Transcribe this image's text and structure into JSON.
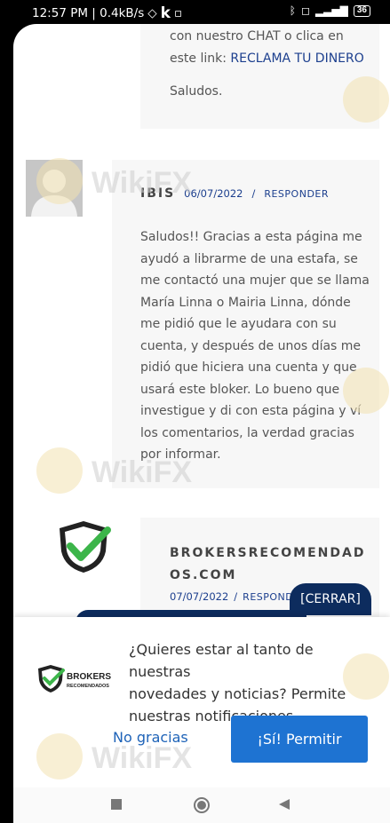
{
  "status_bar": {
    "time_speed": "12:57 PM | 0.4kB/s",
    "k_glyph": "k",
    "battery": "36"
  },
  "comments": {
    "top": {
      "line1": "con nuestro CHAT o clica en",
      "line2_prefix": "este link: ",
      "link": "RECLAMA TU DINERO",
      "sign": "Saludos."
    },
    "ibis": {
      "author": "IBIS",
      "date": "06/07/2022",
      "sep": "/",
      "reply": "RESPONDER",
      "lines": [
        "Saludos!! Gracias a esta página me",
        "ayudó a librarme de una estafa, se",
        "me contactó una mujer que se llama",
        "María Linna o Mairia Linna, dónde",
        "me pidió que le ayudara con su",
        "cuenta, y después de unos días me",
        "pidió que hiciera una cuenta y que",
        "usará este bloker. Lo bueno que",
        "investigue y di con esta página y ví",
        "los comentarios, la verdad gracias",
        "por informar."
      ]
    },
    "brokers": {
      "author_line1": "BROKERSRECOMENDAD",
      "author_line2": "OS.COM",
      "date": "07/07/2022",
      "sep": "/",
      "reply": "RESPOND"
    }
  },
  "cerrar_label": "[CERRAR]",
  "notification": {
    "logo_word": "BROKERS",
    "logo_sub": "RECOMENDADOS",
    "lines": [
      "¿Quieres estar al tanto de nuestras",
      "novedades y noticias? Permite",
      "nuestras notificaciones"
    ],
    "no_label": "No gracias",
    "yes_label": "¡Sí! Permitir"
  },
  "watermark": "WikiFX",
  "colors": {
    "link": "#1c3f8e",
    "button": "#1e73d2",
    "dark_navy": "#0d2c5e",
    "check_green": "#3cb54a"
  }
}
